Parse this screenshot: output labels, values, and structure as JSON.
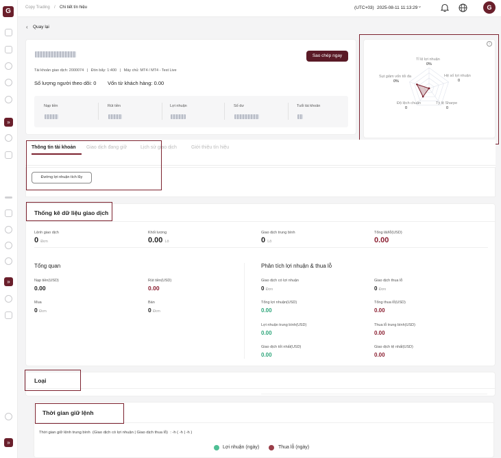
{
  "breadcrumb": {
    "parent": "Copy Trading",
    "current": "Chi tiết tín hiệu"
  },
  "topbar": {
    "timezone": "(UTC+03)",
    "datetime": "2025-08-11 11:13:29",
    "chevron": "⌄"
  },
  "back_label": "Quay lại",
  "account": {
    "info": "Tài khoản giao dịch: 2000074   |   Đòn bẩy: 1:400   |   Máy chủ: MT4 / MT4 - Test Live",
    "followers_label": "Số lượng người theo dõi:",
    "followers_value": "0",
    "capital_label": "Vốn từ khách hàng:",
    "capital_value": "0.00",
    "copy_button": "Sao chép ngay"
  },
  "stats": [
    {
      "label": "Nạp tiền"
    },
    {
      "label": "Rút tiền"
    },
    {
      "label": "Lợi nhuận"
    },
    {
      "label": "Số dư"
    },
    {
      "label": "Tuổi tài khoản"
    }
  ],
  "radar": {
    "labels": [
      {
        "name": "Tỉ lệ lợi nhuận",
        "value": "0%"
      },
      {
        "name": "Hệ số lợi nhuận",
        "value": "0"
      },
      {
        "name": "Tỷ lệ Sharpe",
        "value": "0"
      },
      {
        "name": "Độ lệch chuẩn",
        "value": "0"
      },
      {
        "name": "Sụt giảm vốn tối đa",
        "value": "0%"
      }
    ],
    "levels": [
      0.0,
      0.0,
      0.0,
      0.5,
      0.62
    ]
  },
  "tabs": [
    {
      "label": "Thông tin tài khoản",
      "active": true
    },
    {
      "label": "Giao dịch đang giữ",
      "active": false
    },
    {
      "label": "Lịch sử giao dịch",
      "active": false
    },
    {
      "label": "Giới thiệu tín hiệu",
      "active": false
    }
  ],
  "curve_button": "Đường lợi nhuận tích lũy",
  "trade_stats": {
    "title": "Thống kê dữ liệu giao dịch",
    "top": [
      {
        "label": "Lệnh giao dịch",
        "value": "0",
        "unit": "Đơn"
      },
      {
        "label": "Khối lượng",
        "value": "0.00",
        "unit": "Lô"
      },
      {
        "label": "Giao dịch trung bình",
        "value": "0",
        "unit": "Lô"
      },
      {
        "label": "Tổng lãi/lỗ(USD)",
        "value": "0.00",
        "unit": ""
      }
    ],
    "overview_title": "Tổng quan",
    "overview": [
      {
        "label": "Nạp tiền(USD)",
        "value": "0.00",
        "unit": ""
      },
      {
        "label": "Rút tiền(USD)",
        "value": "0.00",
        "unit": ""
      },
      {
        "label": "Mua",
        "value": "0",
        "unit": "Đơn"
      },
      {
        "label": "Bán",
        "value": "0",
        "unit": "Đơn"
      }
    ],
    "pl_title": "Phân tích lợi nhuận & thua lỗ",
    "pl": [
      {
        "label": "Giao dịch có lợi nhuận",
        "value": "0",
        "unit": "Đơn"
      },
      {
        "label": "Giao dịch thua lỗ",
        "value": "0",
        "unit": "Đơn"
      },
      {
        "label": "Tổng lợi nhuận(USD)",
        "value": "0.00",
        "unit": ""
      },
      {
        "label": "Tổng thua lỗ(USD)",
        "value": "0.00",
        "unit": ""
      },
      {
        "label": "Lợi nhuận trung bình(USD)",
        "value": "0.00",
        "unit": ""
      },
      {
        "label": "Thua lỗ trung bình(USD)",
        "value": "0.00",
        "unit": ""
      },
      {
        "label": "Giao dịch tốt nhất(USD)",
        "value": "0.00",
        "unit": ""
      },
      {
        "label": "Giao dịch tệ nhất(USD)",
        "value": "0.00",
        "unit": ""
      }
    ]
  },
  "type_title": "Loại",
  "hold": {
    "title": "Thời gian giữ lệnh",
    "avg": "Thời gian giữ lệnh trung bình  (Giao dịch có lợi nhuận | Giao dịch thua lỗ)  : -h ( -h | -h )",
    "legend_profit": "Lợi nhuận (ngày)",
    "legend_loss": "Thua lỗ (ngày)"
  },
  "colors": {
    "brand": "#5a1a26",
    "profit": "#4fbf95",
    "loss": "#9a3f4a"
  }
}
